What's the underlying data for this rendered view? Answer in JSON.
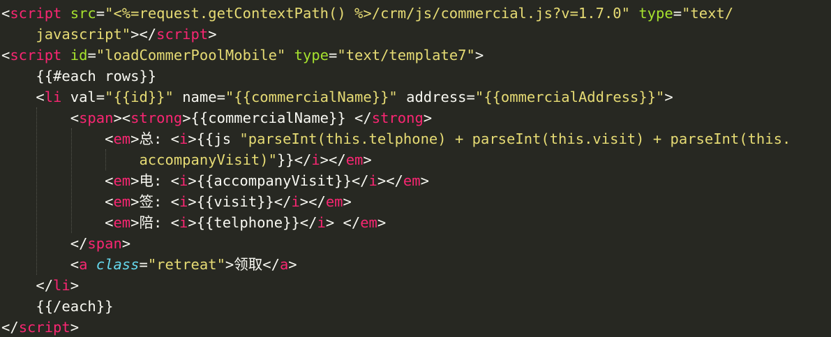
{
  "editor": {
    "theme_colors": {
      "background": "#272822",
      "tag": "#f92672",
      "attribute": "#a6e22e",
      "string": "#e6db74",
      "text": "#f8f8f2",
      "class_keyword": "#66d9ef"
    },
    "lines": [
      {
        "indent": 0,
        "tokens": [
          {
            "t": "plain",
            "v": "<"
          },
          {
            "t": "tag",
            "v": "script"
          },
          {
            "t": "plain",
            "v": " "
          },
          {
            "t": "attr",
            "v": "src"
          },
          {
            "t": "plain",
            "v": "="
          },
          {
            "t": "str",
            "v": "\"<%=request.getContextPath() %>/crm/js/commercial.js?v=1.7.0\""
          },
          {
            "t": "plain",
            "v": " "
          },
          {
            "t": "attr",
            "v": "type"
          },
          {
            "t": "plain",
            "v": "="
          },
          {
            "t": "str",
            "v": "\"text/"
          }
        ]
      },
      {
        "indent": 2,
        "tokens": [
          {
            "t": "str",
            "v": "javascript\""
          },
          {
            "t": "plain",
            "v": "></"
          },
          {
            "t": "tag",
            "v": "script"
          },
          {
            "t": "plain",
            "v": ">"
          }
        ]
      },
      {
        "indent": 0,
        "tokens": [
          {
            "t": "plain",
            "v": "<"
          },
          {
            "t": "tag",
            "v": "script"
          },
          {
            "t": "plain",
            "v": " "
          },
          {
            "t": "attr",
            "v": "id"
          },
          {
            "t": "plain",
            "v": "="
          },
          {
            "t": "str",
            "v": "\"loadCommerPoolMobile\""
          },
          {
            "t": "plain",
            "v": " "
          },
          {
            "t": "attr",
            "v": "type"
          },
          {
            "t": "plain",
            "v": "="
          },
          {
            "t": "str",
            "v": "\"text/template7\""
          },
          {
            "t": "plain",
            "v": ">"
          }
        ]
      },
      {
        "indent": 2,
        "tokens": [
          {
            "t": "plain",
            "v": "{{#each rows}}"
          }
        ]
      },
      {
        "indent": 2,
        "tokens": [
          {
            "t": "plain",
            "v": "<"
          },
          {
            "t": "tag",
            "v": "li"
          },
          {
            "t": "plain",
            "v": " val="
          },
          {
            "t": "str",
            "v": "\"{{id}}\""
          },
          {
            "t": "plain",
            "v": " name="
          },
          {
            "t": "str",
            "v": "\"{{commercialName}}\""
          },
          {
            "t": "plain",
            "v": " address="
          },
          {
            "t": "str",
            "v": "\"{{ommercialAddress}}\""
          },
          {
            "t": "plain",
            "v": ">"
          }
        ]
      },
      {
        "indent": 4,
        "tokens": [
          {
            "t": "plain",
            "v": "<"
          },
          {
            "t": "tag",
            "v": "span"
          },
          {
            "t": "plain",
            "v": "><"
          },
          {
            "t": "tag",
            "v": "strong"
          },
          {
            "t": "plain",
            "v": ">{{commercialName}} </"
          },
          {
            "t": "tag",
            "v": "strong"
          },
          {
            "t": "plain",
            "v": ">"
          }
        ]
      },
      {
        "indent": 6,
        "tokens": [
          {
            "t": "plain",
            "v": "<"
          },
          {
            "t": "tag",
            "v": "em"
          },
          {
            "t": "plain",
            "v": ">总: <"
          },
          {
            "t": "tag",
            "v": "i"
          },
          {
            "t": "plain",
            "v": ">{{js "
          },
          {
            "t": "str",
            "v": "\"parseInt(this.telphone) + parseInt(this.visit) + parseInt(this."
          }
        ]
      },
      {
        "indent": 8,
        "tokens": [
          {
            "t": "str",
            "v": "accompanyVisit)\""
          },
          {
            "t": "plain",
            "v": "}}</"
          },
          {
            "t": "tag",
            "v": "i"
          },
          {
            "t": "plain",
            "v": "></"
          },
          {
            "t": "tag",
            "v": "em"
          },
          {
            "t": "plain",
            "v": ">"
          }
        ]
      },
      {
        "indent": 6,
        "tokens": [
          {
            "t": "plain",
            "v": "<"
          },
          {
            "t": "tag",
            "v": "em"
          },
          {
            "t": "plain",
            "v": ">电: <"
          },
          {
            "t": "tag",
            "v": "i"
          },
          {
            "t": "plain",
            "v": ">{{accompanyVisit}}</"
          },
          {
            "t": "tag",
            "v": "i"
          },
          {
            "t": "plain",
            "v": "></"
          },
          {
            "t": "tag",
            "v": "em"
          },
          {
            "t": "plain",
            "v": ">"
          }
        ]
      },
      {
        "indent": 6,
        "tokens": [
          {
            "t": "plain",
            "v": "<"
          },
          {
            "t": "tag",
            "v": "em"
          },
          {
            "t": "plain",
            "v": ">签: <"
          },
          {
            "t": "tag",
            "v": "i"
          },
          {
            "t": "plain",
            "v": ">{{visit}}</"
          },
          {
            "t": "tag",
            "v": "i"
          },
          {
            "t": "plain",
            "v": "></"
          },
          {
            "t": "tag",
            "v": "em"
          },
          {
            "t": "plain",
            "v": ">"
          }
        ]
      },
      {
        "indent": 6,
        "tokens": [
          {
            "t": "plain",
            "v": "<"
          },
          {
            "t": "tag",
            "v": "em"
          },
          {
            "t": "plain",
            "v": ">陪: <"
          },
          {
            "t": "tag",
            "v": "i"
          },
          {
            "t": "plain",
            "v": ">{{telphone}}</"
          },
          {
            "t": "tag",
            "v": "i"
          },
          {
            "t": "plain",
            "v": "> </"
          },
          {
            "t": "tag",
            "v": "em"
          },
          {
            "t": "plain",
            "v": ">"
          }
        ]
      },
      {
        "indent": 4,
        "tokens": [
          {
            "t": "plain",
            "v": "</"
          },
          {
            "t": "tag",
            "v": "span"
          },
          {
            "t": "plain",
            "v": ">"
          }
        ]
      },
      {
        "indent": 4,
        "tokens": [
          {
            "t": "plain",
            "v": "<"
          },
          {
            "t": "tag",
            "v": "a"
          },
          {
            "t": "plain",
            "v": " "
          },
          {
            "t": "ital",
            "v": "class"
          },
          {
            "t": "plain",
            "v": "="
          },
          {
            "t": "str",
            "v": "\"retreat\""
          },
          {
            "t": "plain",
            "v": ">领取</"
          },
          {
            "t": "tag",
            "v": "a"
          },
          {
            "t": "plain",
            "v": ">"
          }
        ]
      },
      {
        "indent": 2,
        "tokens": [
          {
            "t": "plain",
            "v": "</"
          },
          {
            "t": "tag",
            "v": "li"
          },
          {
            "t": "plain",
            "v": ">"
          }
        ]
      },
      {
        "indent": 2,
        "tokens": [
          {
            "t": "plain",
            "v": "{{/each}}"
          }
        ]
      },
      {
        "indent": 0,
        "tokens": [
          {
            "t": "plain",
            "v": "</"
          },
          {
            "t": "tag",
            "v": "script"
          },
          {
            "t": "plain",
            "v": ">"
          }
        ]
      }
    ]
  }
}
